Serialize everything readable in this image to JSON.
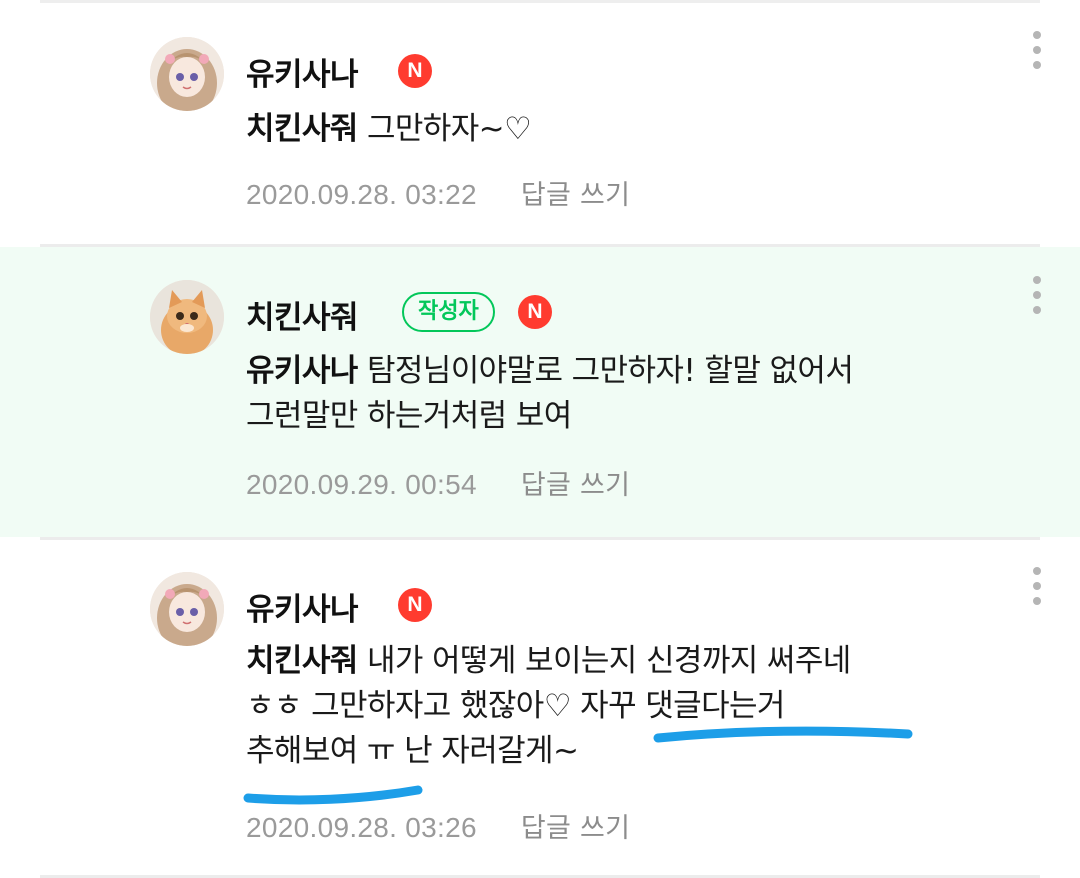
{
  "comments": [
    {
      "nickname": "유키사나",
      "is_author": false,
      "n_badge": "N",
      "avatar": "anime-girl-avatar",
      "body_lines": [
        {
          "mention": "치킨사줘",
          "text": " 그만하자~♡"
        }
      ],
      "date": "2020.09.28. 03:22",
      "reply_label": "답글 쓰기"
    },
    {
      "nickname": "치킨사줘",
      "is_author": true,
      "author_label": "작성자",
      "n_badge": "N",
      "avatar": "kitten-avatar",
      "body_lines": [
        {
          "mention": "유키사나",
          "text": " 탐정님이야말로 그만하자! 할말 없어서"
        },
        {
          "mention": "",
          "text": "그런말만 하는거처럼 보여"
        }
      ],
      "date": "2020.09.29. 00:54",
      "reply_label": "답글 쓰기"
    },
    {
      "nickname": "유키사나",
      "is_author": false,
      "n_badge": "N",
      "avatar": "anime-girl-avatar",
      "body_lines": [
        {
          "mention": "치킨사줘",
          "text": " 내가 어떻게 보이는지 신경까지 써주네"
        },
        {
          "mention": "",
          "text": "ㅎㅎ 그만하자고 했잖아♡ 자꾸 댓글다는거"
        },
        {
          "mention": "",
          "text": "추해보여 ㅠ 난 자러갈게~"
        }
      ],
      "date": "2020.09.28. 03:26",
      "reply_label": "답글 쓰기"
    }
  ],
  "colors": {
    "author_bg": "#f1fcf5",
    "author_badge": "#03c75a",
    "n_badge": "#ff3b2f",
    "highlight_marker": "#1d9ee8",
    "meta_text": "#9a9a9a"
  },
  "icons": {
    "more": "more-vertical-icon",
    "new": "new-badge-icon"
  }
}
